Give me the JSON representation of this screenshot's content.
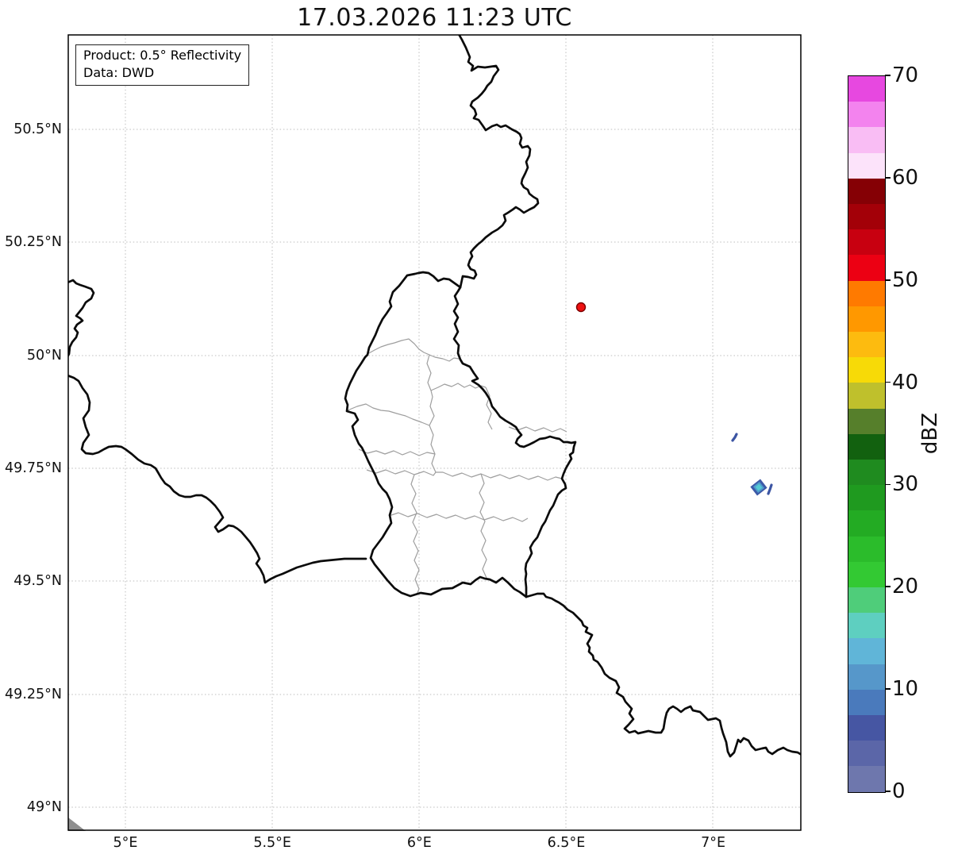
{
  "title": "17.03.2026 11:23 UTC",
  "info_box": {
    "line1": "Product: 0.5° Reflectivity",
    "line2": "Data: DWD"
  },
  "axes": {
    "x_ticks": [
      {
        "label": "5°E",
        "lon": 5.0
      },
      {
        "label": "5.5°E",
        "lon": 5.5
      },
      {
        "label": "6°E",
        "lon": 6.0
      },
      {
        "label": "6.5°E",
        "lon": 6.5
      },
      {
        "label": "7°E",
        "lon": 7.0
      }
    ],
    "y_ticks": [
      {
        "label": "50.5°N",
        "lat": 50.5
      },
      {
        "label": "50.25°N",
        "lat": 50.25
      },
      {
        "label": "50°N",
        "lat": 50.0
      },
      {
        "label": "49.75°N",
        "lat": 49.75
      },
      {
        "label": "49.5°N",
        "lat": 49.5
      },
      {
        "label": "49.25°N",
        "lat": 49.25
      },
      {
        "label": "49°N",
        "lat": 49.0
      }
    ],
    "lon_range": [
      4.805,
      7.3
    ],
    "lat_range": [
      48.95,
      50.71
    ],
    "grid": "dotted"
  },
  "colorbar": {
    "label": "dBZ",
    "ticks": [
      0,
      10,
      20,
      30,
      40,
      50,
      60,
      70
    ],
    "vmin": 0,
    "vmax": 70,
    "band_step_dbz": 2.5,
    "band_colors_bottom_to_top": [
      "#6e77ad",
      "#5b66a8",
      "#4656a3",
      "#4a7abc",
      "#5697ca",
      "#60b5d8",
      "#5ecfc0",
      "#4fcd7a",
      "#33c933",
      "#2bbc2b",
      "#23ab23",
      "#1f9a1f",
      "#1f8b1f",
      "#12610f",
      "#567f2b",
      "#bfc02c",
      "#f7da07",
      "#fdbb0f",
      "#ff9800",
      "#ff7a00",
      "#ec0013",
      "#c80010",
      "#a30008",
      "#850005",
      "#fce3fa",
      "#f9bdf4",
      "#f383ee",
      "#e748e0"
    ]
  },
  "map": {
    "radar_marker": {
      "name": "radar site",
      "lon": 6.55,
      "lat": 50.11,
      "color": "#ee1111"
    },
    "echoes": [
      {
        "name": "small echo streak",
        "lon": 7.07,
        "lat": 49.82,
        "approx_dbz": "0-10",
        "color": "#3c55a3"
      },
      {
        "name": "echo cluster",
        "lon": 7.16,
        "lat": 49.71,
        "approx_dbz": "0-15",
        "colors": [
          "#3d5aa8",
          "#4f9fcc",
          "#55cbd4"
        ]
      },
      {
        "name": "small echo streak",
        "lon": 7.19,
        "lat": 49.7,
        "approx_dbz": "0-10",
        "color": "#3c55a3"
      }
    ],
    "countries_shown": [
      "Belgium",
      "Germany",
      "Luxembourg",
      "France"
    ],
    "inner_divisions": "Luxembourg cantons"
  }
}
